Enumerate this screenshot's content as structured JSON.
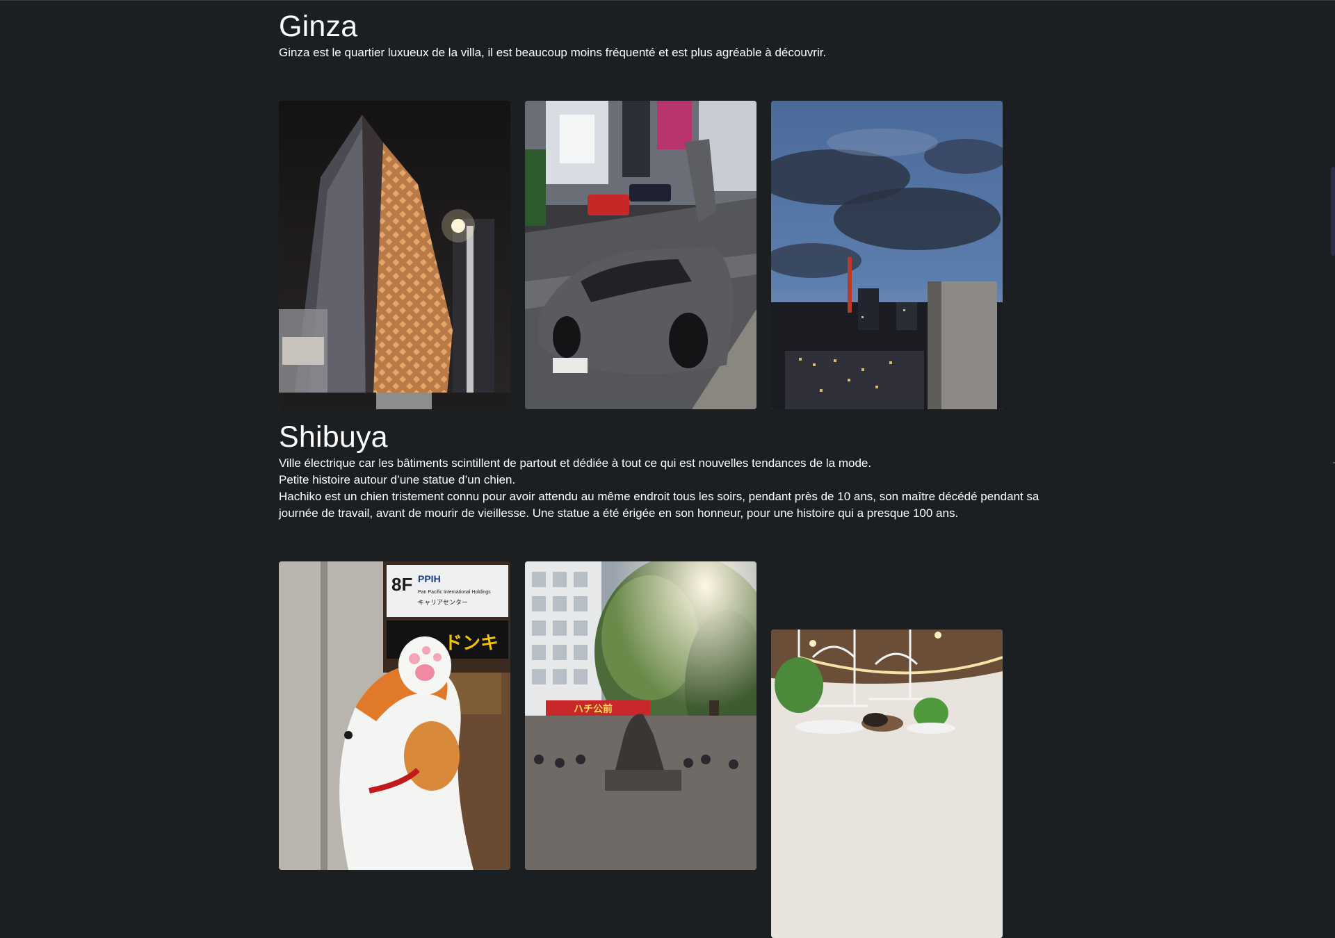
{
  "sections": [
    {
      "title": "Ginza",
      "paragraphs": [
        "Ginza est le quartier luxueux de la villa, il est beaucoup moins fréquenté et est plus agréable à découvrir."
      ],
      "photos": [
        {
          "subject": "illuminated-building-night"
        },
        {
          "subject": "sports-car-gullwing-doors"
        },
        {
          "subject": "city-skyline-dusk"
        }
      ]
    },
    {
      "title": "Shibuya",
      "paragraphs": [
        "Ville électrique car les bâtiments scintillent de partout et dédiée à tout ce qui est nouvelles tendances de la mode.",
        "Petite histoire autour d’une statue d’un chien.",
        "Hachiko est un chien tristement connu pour avoir attendu au même endroit tous les soirs, pendant près de 10 ans, son maître décédé pendant sa journée de travail, avant de mourir de vieillesse. Une statue a été érigée en son honneur, pour une histoire qui a presque 100 ans."
      ],
      "photos": [
        {
          "subject": "lucky-dog-figurine",
          "sign_floor": "8F",
          "sign_brand": "PPIH",
          "sign_sub": "Pan Pacific International Holdings",
          "sign_jp": "キャリアセンター",
          "store_sign": "ドンキ"
        },
        {
          "subject": "hachiko-statue-under-tree",
          "sign_text": "ハチ公前"
        },
        {
          "subject": "cat-cafe-interior"
        }
      ]
    }
  ],
  "colors": {
    "background": "#1c1f22",
    "text": "#ffffff",
    "scrollbar": "#2b2e47"
  }
}
